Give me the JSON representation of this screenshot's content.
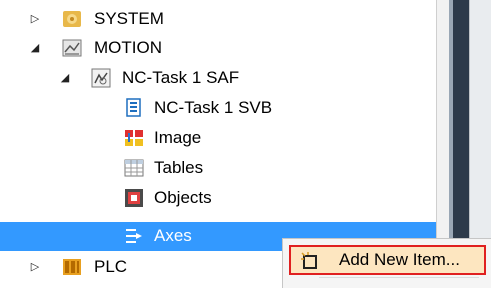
{
  "tree": {
    "items": [
      {
        "label": "SYSTEM",
        "icon": "system-icon",
        "expander": "collapsed"
      },
      {
        "label": "MOTION",
        "icon": "motion-icon",
        "expander": "expanded"
      },
      {
        "label": "NC-Task 1 SAF",
        "icon": "nc-task-icon",
        "expander": "expanded"
      },
      {
        "label": "NC-Task 1 SVB",
        "icon": "svb-icon"
      },
      {
        "label": "Image",
        "icon": "image-icon"
      },
      {
        "label": "Tables",
        "icon": "tables-icon"
      },
      {
        "label": "Objects",
        "icon": "objects-icon"
      },
      {
        "label": "Axes",
        "icon": "axes-icon",
        "selected": true
      },
      {
        "label": "PLC",
        "icon": "plc-icon",
        "expander": "collapsed"
      }
    ]
  },
  "context_menu": {
    "items": [
      {
        "label": "Add New Item...",
        "icon": "add-item-icon",
        "highlighted": true
      }
    ]
  },
  "colors": {
    "selection": "#3399ff",
    "highlight_border": "#e02020"
  }
}
